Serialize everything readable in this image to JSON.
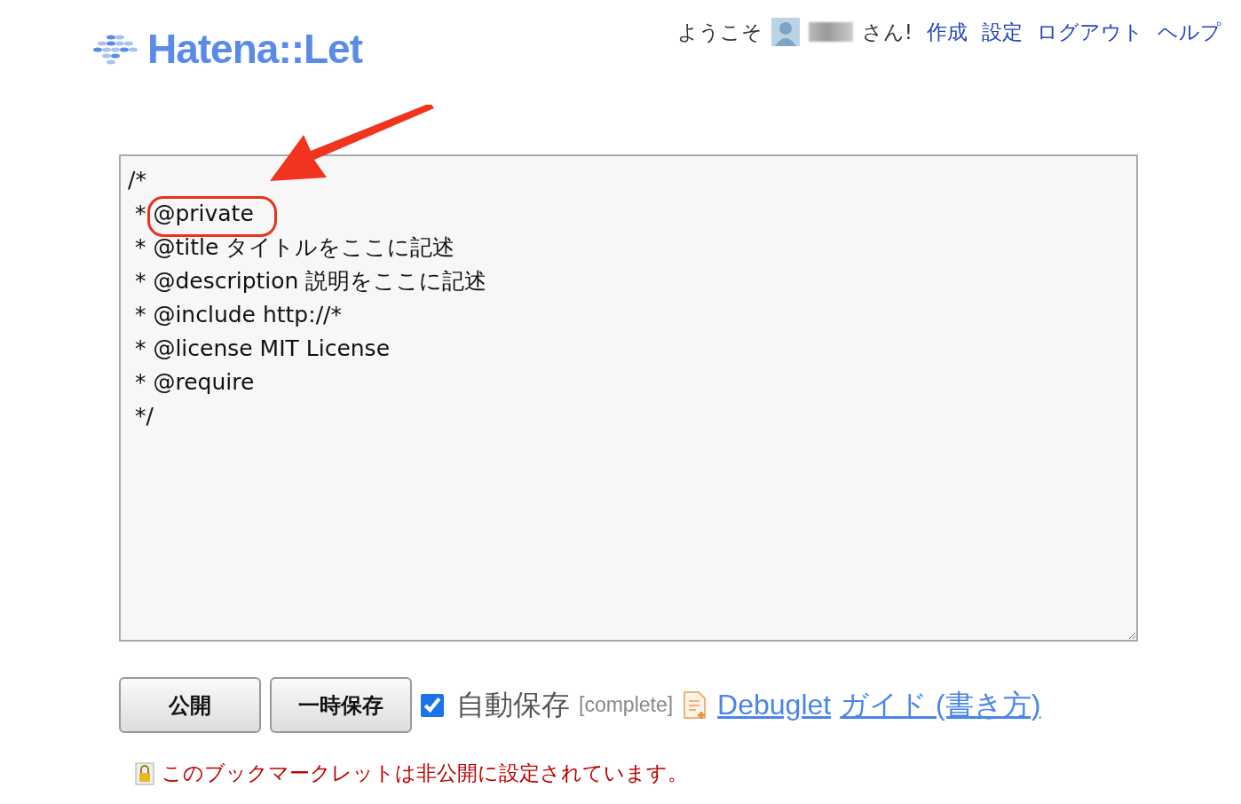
{
  "logo": {
    "text": "Hatena::Let"
  },
  "user_nav": {
    "greeting": "ようこそ",
    "suffix": "さん!",
    "links": [
      "作成",
      "設定",
      "ログアウト",
      "ヘルプ"
    ]
  },
  "editor": {
    "lines": [
      "/*",
      " * @private",
      " * @title タイトルをここに記述",
      " * @description 説明をここに記述",
      " * @include http://*",
      " * @license MIT License",
      " * @require",
      " */"
    ]
  },
  "actions": {
    "buttons": [
      "公開",
      "一時保存"
    ],
    "autosave": {
      "label": "自動保存",
      "checked": true
    },
    "status": "[complete]",
    "links": [
      "Debuglet",
      "ガイド (書き方)"
    ]
  },
  "notice": "このブックマークレットは非公開に設定されています。"
}
